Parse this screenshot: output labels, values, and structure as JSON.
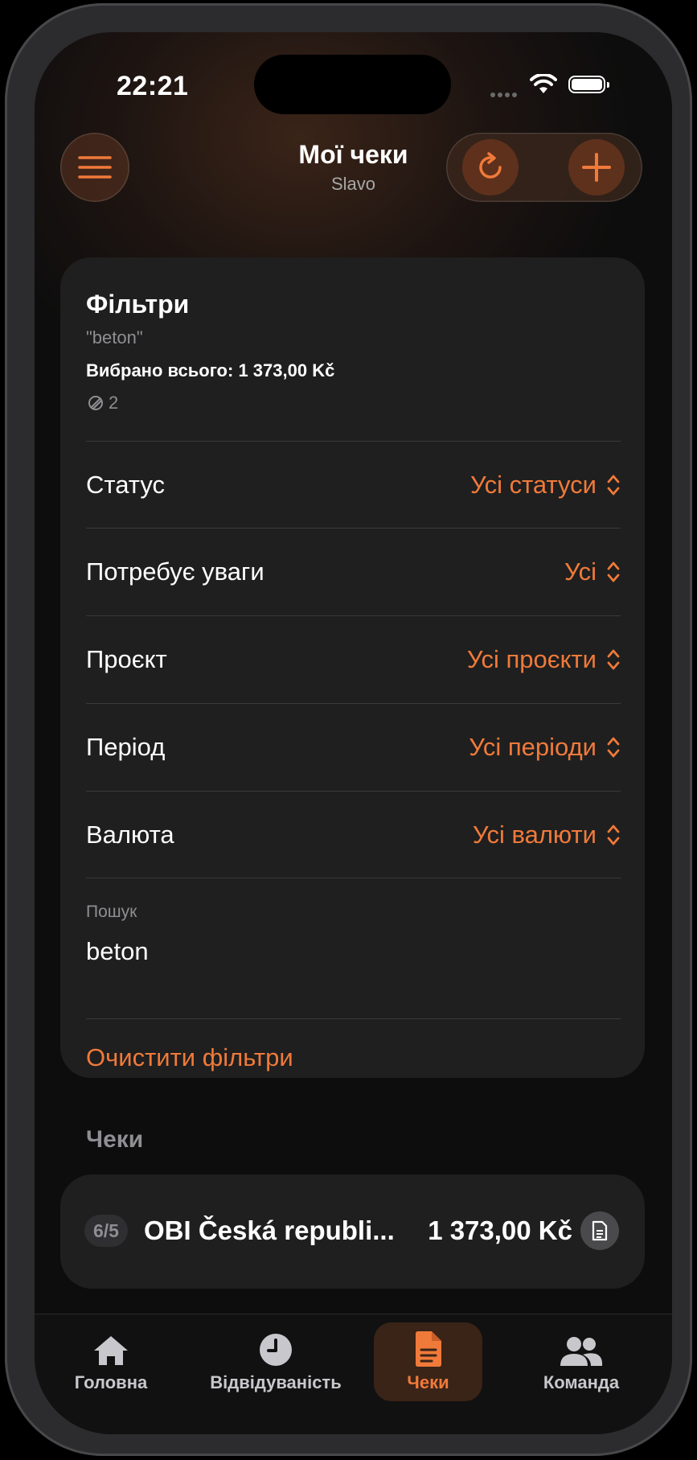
{
  "status_bar": {
    "time": "22:21"
  },
  "header": {
    "title": "Мої чеки",
    "subtitle": "Slavo"
  },
  "filters": {
    "title": "Фільтри",
    "query": "\"beton\"",
    "total": "Вибрано всього: 1 373,00 Kč",
    "count": "2",
    "rows": [
      {
        "label": "Статус",
        "value": "Усі статуси"
      },
      {
        "label": "Потребує уваги",
        "value": "Усі"
      },
      {
        "label": "Проєкт",
        "value": "Усі проєкти"
      },
      {
        "label": "Період",
        "value": "Усі періоди"
      },
      {
        "label": "Валюта",
        "value": "Усі валюти"
      }
    ],
    "search_label": "Пошук",
    "search_value": "beton",
    "clear_label": "Очистити фільтри"
  },
  "receipts": {
    "section_title": "Чеки",
    "items": [
      {
        "badge": "6/5",
        "name": "OBI Česká republi...",
        "amount": "1 373,00 Kč"
      }
    ]
  },
  "tabbar": {
    "items": [
      {
        "label": "Головна",
        "icon": "home-icon"
      },
      {
        "label": "Відвідуваність",
        "icon": "clock-icon"
      },
      {
        "label": "Чеки",
        "icon": "document-icon",
        "active": true
      },
      {
        "label": "Команда",
        "icon": "people-icon"
      }
    ]
  },
  "colors": {
    "accent": "#f07a3a",
    "card": "#1f1f1f",
    "background": "#0d0d0d"
  }
}
